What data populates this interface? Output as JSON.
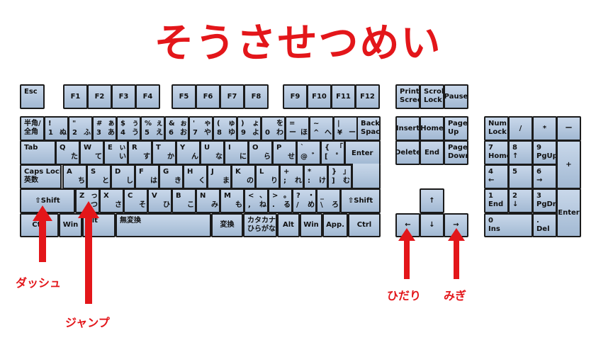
{
  "title": "そうさせつめい",
  "labels": {
    "dash": "ダッシュ",
    "jump": "ジャンプ",
    "left": "ひだり",
    "right": "みぎ"
  },
  "keys": {
    "esc": "Esc",
    "f1": "F1",
    "f2": "F2",
    "f3": "F3",
    "f4": "F4",
    "f5": "F5",
    "f6": "F6",
    "f7": "F7",
    "f8": "F8",
    "f9": "F9",
    "f10": "F10",
    "f11": "F11",
    "f12": "F12",
    "prtsc": "Print\nScreen",
    "scrlk": "Scroll\nLock",
    "pause": "Pause",
    "hankaku": "半角/\n全角",
    "n1": [
      "!",
      "",
      "1",
      "ぬ"
    ],
    "n2": [
      "\"",
      "",
      "2",
      "ふ"
    ],
    "n3": [
      "#",
      "ぁ",
      "3",
      "あ"
    ],
    "n4": [
      "$",
      "ぅ",
      "4",
      "う"
    ],
    "n5": [
      "%",
      "ぇ",
      "5",
      "え"
    ],
    "n6": [
      "&",
      "ぉ",
      "6",
      "お"
    ],
    "n7": [
      "'",
      "ゃ",
      "7",
      "や"
    ],
    "n8": [
      "(",
      "ゅ",
      "8",
      "ゆ"
    ],
    "n9": [
      ")",
      "ょ",
      "9",
      "よ"
    ],
    "n0": [
      "",
      "を",
      "0",
      "わ"
    ],
    "minus": [
      "=",
      "",
      "ー",
      "ほ"
    ],
    "caret": [
      "~",
      "",
      "^",
      "へ"
    ],
    "yen": [
      "|",
      "",
      "¥",
      "ー"
    ],
    "backspace": "Back\nSpace",
    "tab": "Tab",
    "q": [
      "Q",
      "",
      "",
      "た"
    ],
    "w": [
      "W",
      "",
      "",
      "て"
    ],
    "e": [
      "E",
      "ぃ",
      "",
      "い"
    ],
    "r": [
      "R",
      "",
      "",
      "す"
    ],
    "t": [
      "T",
      "",
      "",
      "か"
    ],
    "y": [
      "Y",
      "",
      "",
      "ん"
    ],
    "u": [
      "U",
      "",
      "",
      "な"
    ],
    "i": [
      "I",
      "",
      "",
      "に"
    ],
    "o": [
      "O",
      "",
      "",
      "ら"
    ],
    "p": [
      "P",
      "",
      "",
      "せ"
    ],
    "at": [
      "`",
      "",
      "@",
      "゛"
    ],
    "lbracket": [
      "{",
      "「",
      "[",
      "゜"
    ],
    "enter": "Enter",
    "caps": "Caps Lock\n英数",
    "a": [
      "A",
      "",
      "",
      "ち"
    ],
    "s": [
      "S",
      "",
      "",
      "と"
    ],
    "d": [
      "D",
      "",
      "",
      "し"
    ],
    "f": [
      "F",
      "",
      "",
      "は"
    ],
    "g": [
      "G",
      "",
      "",
      "き"
    ],
    "h": [
      "H",
      "",
      "",
      "く"
    ],
    "j": [
      "J",
      "",
      "",
      "ま"
    ],
    "k": [
      "K",
      "",
      "",
      "の"
    ],
    "l": [
      "L",
      "",
      "",
      "り"
    ],
    "semi": [
      "+",
      "",
      ";",
      "れ"
    ],
    "colon": [
      "*",
      "",
      ":",
      "け"
    ],
    "rbracket": [
      "}",
      "」",
      "]",
      "む"
    ],
    "lshift": "⇧Shift",
    "z": [
      "Z",
      "っ",
      "",
      "つ"
    ],
    "x": [
      "X",
      "",
      "",
      "さ"
    ],
    "c": [
      "C",
      "",
      "",
      "そ"
    ],
    "v": [
      "V",
      "",
      "",
      "ひ"
    ],
    "b": [
      "B",
      "",
      "",
      "こ"
    ],
    "n": [
      "N",
      "",
      "",
      "み"
    ],
    "m": [
      "M",
      "",
      "",
      "も"
    ],
    "comma": [
      "<",
      "、",
      ",",
      "ね"
    ],
    "period": [
      ">",
      "。",
      ".",
      "る"
    ],
    "slash": [
      "?",
      "・",
      "/",
      "め"
    ],
    "backslash": [
      "_",
      "",
      "\\",
      "ろ"
    ],
    "rshift": "⇧Shift",
    "lctrl": "Ctrl",
    "lwin": "Win",
    "alt": "Alt",
    "muhenkan": "無変換",
    "henkan": "変換",
    "kana": "カタカナ\nひらがな",
    "ralt": "Alt",
    "rwin": "Win",
    "app": "App.",
    "rctrl": "Ctrl",
    "insert": "Insert",
    "home": "Home",
    "pgup": "Page\nUp",
    "delete": "Delete",
    "end": "End",
    "pgdn": "Page\nDown",
    "up": "↑",
    "left": "←",
    "down": "↓",
    "right": "→",
    "numlock": "Num\nLock",
    "kpdiv": "/",
    "kpmul": "*",
    "kpminus": "ー",
    "kp7": "7\nHome",
    "kp8": "8\n↑",
    "kp9": "9\nPgUp",
    "kpplus": "+",
    "kp4": "4\n←",
    "kp5": "5",
    "kp6": "6\n→",
    "kp1": "1\nEnd",
    "kp2": "2\n↓",
    "kp3": "3\nPgDn",
    "kpenter": "Enter",
    "kp0": "0\nIns",
    "kpdot": ".\nDel"
  },
  "colors": {
    "accent": "#e3161a",
    "key_top": "#c9d8ea",
    "key_bottom": "#a2b9d3"
  }
}
